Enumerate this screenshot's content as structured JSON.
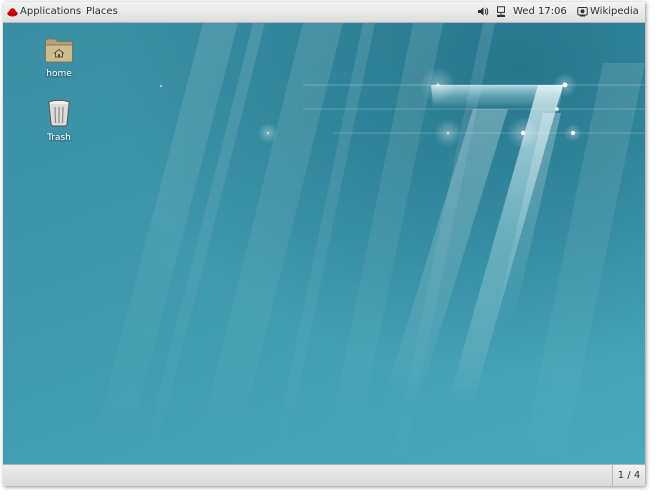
{
  "top_panel": {
    "applications_label": "Applications",
    "places_label": "Places",
    "clock": "Wed 17:06",
    "active_window": "Wikipedia"
  },
  "desktop": {
    "icons": [
      {
        "label": "home",
        "icon": "folder-home-icon"
      },
      {
        "label": "Trash",
        "icon": "trash-icon"
      }
    ]
  },
  "bottom_panel": {
    "workspace": "1 / 4"
  },
  "colors": {
    "panel": "#e6e6e6",
    "wallpaper_base": "#3d93a6",
    "wallpaper_dark": "#1f6f86",
    "folder": "#c9b68c"
  }
}
